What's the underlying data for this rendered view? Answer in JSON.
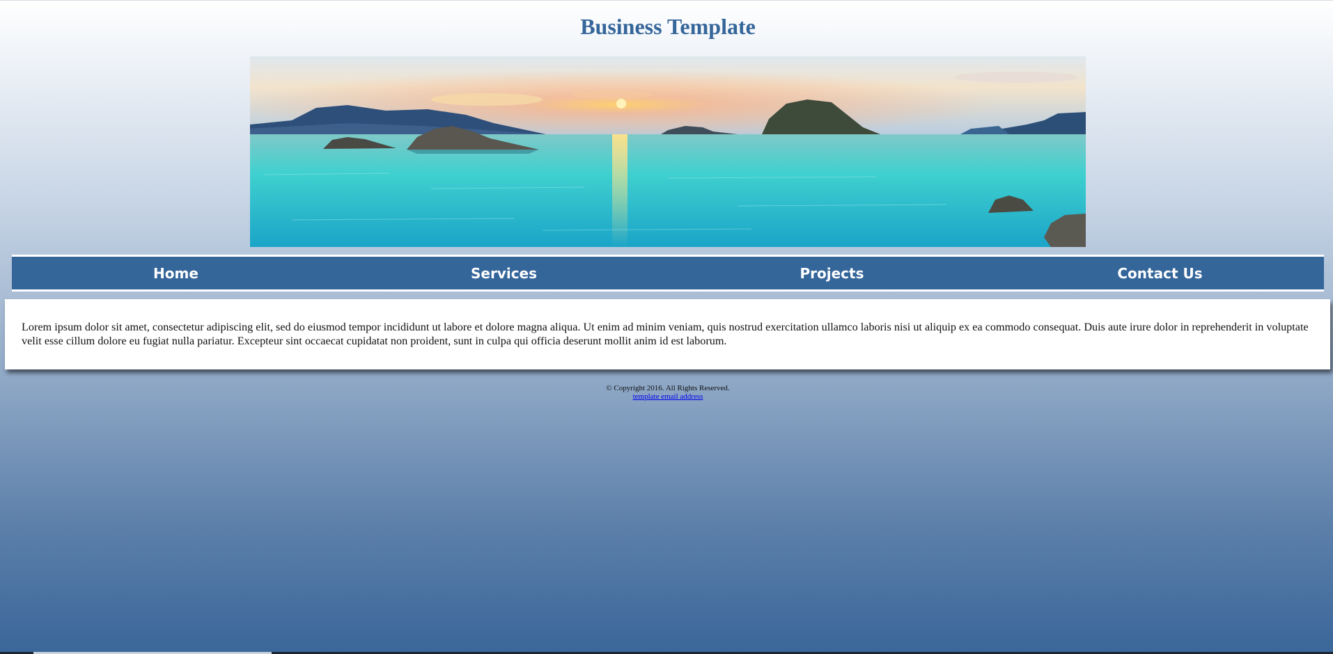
{
  "header": {
    "title": "Business Template"
  },
  "banner": {
    "icon": "sunset-seascape-image",
    "colors": {
      "sky_top": "#c7dcef",
      "sun": "#ffcf6a",
      "sea": "#2fc4c9",
      "islands": "#2e4f7a"
    }
  },
  "nav": {
    "items": [
      {
        "label": "Home"
      },
      {
        "label": "Services"
      },
      {
        "label": "Projects"
      },
      {
        "label": "Contact Us"
      }
    ],
    "background": "#35669a"
  },
  "main": {
    "paragraph": "Lorem ipsum dolor sit amet, consectetur adipiscing elit, sed do eiusmod tempor incididunt ut labore et dolore magna aliqua. Ut enim ad minim veniam, quis nostrud exercitation ullamco laboris nisi ut aliquip ex ea commodo consequat. Duis aute irure dolor in reprehenderit in voluptate velit esse cillum dolore eu fugiat nulla pariatur. Excepteur sint occaecat cupidatat non proident, sunt in culpa qui officia deserunt mollit anim id est laborum."
  },
  "footer": {
    "copyright": "© Copyright 2016. All Rights Reserved.",
    "email_link": "template email address"
  }
}
